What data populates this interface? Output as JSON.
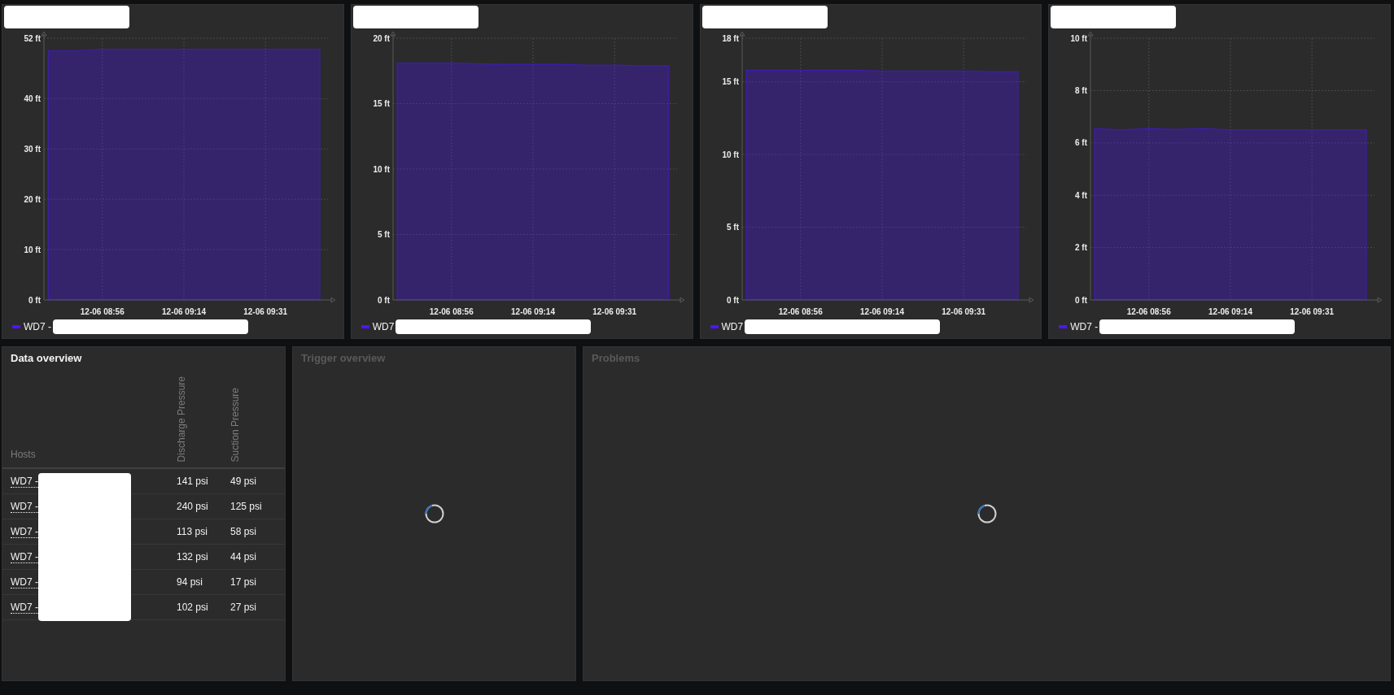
{
  "graphs": [
    {
      "title_redacted": true,
      "legend_redacted": true,
      "chart_data": {
        "type": "area",
        "grid": true,
        "categories": [
          null,
          null,
          "12-06 08:56",
          null,
          null,
          "12-06 09:14",
          null,
          null,
          "12-06 09:31",
          null,
          null
        ],
        "ylim": [
          0,
          52
        ],
        "yticks": [
          {
            "value": 0,
            "label": "0 ft"
          },
          {
            "value": 10,
            "label": "10 ft"
          },
          {
            "value": 20,
            "label": "20 ft"
          },
          {
            "value": 30,
            "label": "30 ft"
          },
          {
            "value": 40,
            "label": "40 ft"
          },
          {
            "value": 52,
            "label": "52 ft"
          }
        ],
        "series": [
          {
            "name": "WD7 -",
            "color": "#4c14ff",
            "values": [
              49.5,
              49.5,
              49.8,
              49.8,
              49.8,
              49.8,
              49.8,
              49.8,
              49.8,
              49.8,
              49.8
            ]
          }
        ]
      }
    },
    {
      "title_redacted": true,
      "legend_redacted": true,
      "chart_data": {
        "type": "area",
        "grid": true,
        "categories": [
          null,
          null,
          "12-06 08:56",
          null,
          null,
          "12-06 09:14",
          null,
          null,
          "12-06 09:31",
          null,
          null
        ],
        "ylim": [
          0,
          20
        ],
        "yticks": [
          {
            "value": 0,
            "label": "0 ft"
          },
          {
            "value": 5,
            "label": "5 ft"
          },
          {
            "value": 10,
            "label": "10 ft"
          },
          {
            "value": 15,
            "label": "15 ft"
          },
          {
            "value": 20,
            "label": "20 ft"
          }
        ],
        "series": [
          {
            "name": "WD7",
            "color": "#4c14ff",
            "values": [
              18.1,
              18.1,
              18.1,
              18.05,
              18.0,
              18.0,
              18.0,
              17.95,
              17.95,
              17.9,
              17.9
            ]
          }
        ]
      }
    },
    {
      "title_redacted": true,
      "legend_redacted": true,
      "chart_data": {
        "type": "area",
        "grid": true,
        "categories": [
          null,
          null,
          "12-06 08:56",
          null,
          null,
          "12-06 09:14",
          null,
          null,
          "12-06 09:31",
          null,
          null
        ],
        "ylim": [
          0,
          18
        ],
        "yticks": [
          {
            "value": 0,
            "label": "0 ft"
          },
          {
            "value": 5,
            "label": "5 ft"
          },
          {
            "value": 10,
            "label": "10 ft"
          },
          {
            "value": 15,
            "label": "15 ft"
          },
          {
            "value": 18,
            "label": "18 ft"
          }
        ],
        "series": [
          {
            "name": "WD7",
            "color": "#4c14ff",
            "values": [
              15.8,
              15.8,
              15.8,
              15.8,
              15.8,
              15.75,
              15.75,
              15.75,
              15.75,
              15.7,
              15.7
            ]
          }
        ]
      }
    },
    {
      "title_redacted": true,
      "legend_redacted": true,
      "chart_data": {
        "type": "area",
        "grid": true,
        "categories": [
          null,
          null,
          "12-06 08:56",
          null,
          null,
          "12-06 09:14",
          null,
          null,
          "12-06 09:31",
          null,
          null
        ],
        "ylim": [
          0,
          10
        ],
        "yticks": [
          {
            "value": 0,
            "label": "0 ft"
          },
          {
            "value": 2,
            "label": "2 ft"
          },
          {
            "value": 4,
            "label": "4 ft"
          },
          {
            "value": 6,
            "label": "6 ft"
          },
          {
            "value": 8,
            "label": "8 ft"
          },
          {
            "value": 10,
            "label": "10 ft"
          }
        ],
        "series": [
          {
            "name": "WD7 -",
            "color": "#4c14ff",
            "values": [
              6.55,
              6.5,
              6.55,
              6.52,
              6.55,
              6.5,
              6.5,
              6.5,
              6.5,
              6.5,
              6.5
            ]
          }
        ]
      }
    }
  ],
  "data_overview": {
    "title": "Data overview",
    "hosts_redacted": true,
    "columns": [
      "Hosts",
      "Discharge Pressure",
      "Suction Pressure"
    ],
    "rows": [
      {
        "host": "WD7 -",
        "values": [
          "141 psi",
          "49 psi"
        ]
      },
      {
        "host": "WD7 -",
        "values": [
          "240 psi",
          "125 psi"
        ]
      },
      {
        "host": "WD7 -",
        "values": [
          "113 psi",
          "58 psi"
        ]
      },
      {
        "host": "WD7 -",
        "values": [
          "132 psi",
          "44 psi"
        ]
      },
      {
        "host": "WD7 -",
        "values": [
          "94 psi",
          "17 psi"
        ]
      },
      {
        "host": "WD7 -",
        "values": [
          "102 psi",
          "27 psi"
        ]
      }
    ]
  },
  "trigger_overview": {
    "title": "Trigger overview",
    "loading": true
  },
  "problems": {
    "title": "Problems",
    "loading": true
  }
}
